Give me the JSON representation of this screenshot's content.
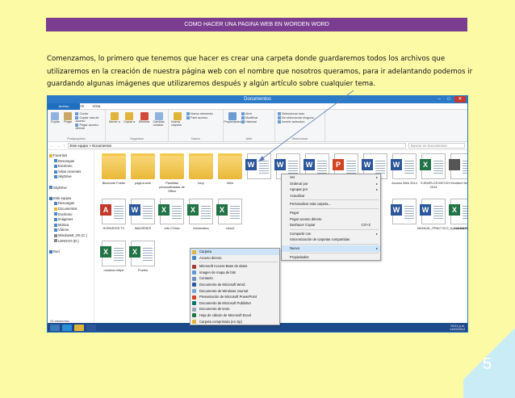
{
  "header": {
    "title": "COMO HACER UNA PAGINA WEB EN WORDEN WORD"
  },
  "intro": "Comenzamos, lo primero que tenemos que hacer es crear una carpeta donde guardaremos todos los archivos que utilizaremos en la creación de nuestra página web con el nombre que nosotros queramos, para ir adelantando podemos ir guardando algunas imágenes que utilizaremos después y algún artículo sobre cualquier tema.",
  "page_number": "5",
  "explorer": {
    "window_title": "Documentos",
    "ribbon_tabs": [
      "Archivo",
      "Inicio",
      "Compartir",
      "Vista"
    ],
    "ribbon": {
      "clipboard": {
        "name": "Portapapeles",
        "copy": "Copiar",
        "paste": "Pegar",
        "items": [
          "Cortar",
          "Copiar ruta de acceso",
          "Pegar acceso directo"
        ]
      },
      "organize": {
        "name": "Organizar",
        "items": [
          "Mover a",
          "Copiar a",
          "Eliminar",
          "Cambiar nombre"
        ]
      },
      "new": {
        "name": "Nuevo",
        "new_folder": "Nueva carpeta",
        "items": [
          "Nuevo elemento",
          "Fácil acceso"
        ]
      },
      "open": {
        "name": "Abrir",
        "properties": "Propiedades",
        "items": [
          "Abrir",
          "Modificar",
          "Historial"
        ]
      },
      "select": {
        "name": "Seleccionar",
        "items": [
          "Seleccionar todo",
          "No seleccionar ninguno",
          "Invertir selección"
        ]
      }
    },
    "address": "Este equipo > Documentos",
    "search_placeholder": "Buscar en Documentos",
    "nav": [
      {
        "label": "Favoritos",
        "indent": 0,
        "color": "#e0b43a"
      },
      {
        "label": "Descargas",
        "indent": 1,
        "color": "#4a86c8"
      },
      {
        "label": "Escritorio",
        "indent": 1,
        "color": "#4a86c8"
      },
      {
        "label": "Sitios recientes",
        "indent": 1,
        "color": "#4a86c8"
      },
      {
        "label": "SkyDrive",
        "indent": 1,
        "color": "#4a86c8"
      },
      {
        "label": "",
        "indent": 0,
        "color": ""
      },
      {
        "label": "SkyDrive",
        "indent": 0,
        "color": "#4a86c8"
      },
      {
        "label": "",
        "indent": 0,
        "color": ""
      },
      {
        "label": "Este equipo",
        "indent": 0,
        "color": "#3a78b8"
      },
      {
        "label": "Descargas",
        "indent": 1,
        "color": "#4a86c8"
      },
      {
        "label": "Documentos",
        "indent": 1,
        "color": "#e0b43a"
      },
      {
        "label": "Escritorio",
        "indent": 1,
        "color": "#4a86c8"
      },
      {
        "label": "Imágenes",
        "indent": 1,
        "color": "#4a86c8"
      },
      {
        "label": "Música",
        "indent": 1,
        "color": "#4a86c8"
      },
      {
        "label": "Vídeos",
        "indent": 1,
        "color": "#4a86c8"
      },
      {
        "label": "Windows8_OS (C:)",
        "indent": 1,
        "color": "#888888"
      },
      {
        "label": "LENOVO (D:)",
        "indent": 1,
        "color": "#888888"
      },
      {
        "label": "",
        "indent": 0,
        "color": ""
      },
      {
        "label": "Red",
        "indent": 0,
        "color": "#3a78b8"
      }
    ],
    "files_row1": [
      "Bluetooth Folder",
      "pagina web",
      "Plantillas personalizadas de Office",
      "tony",
      "Web",
      "",
      "",
      "",
      "",
      "",
      "Acceso Web 2014",
      "EJEMPLOS INFO 2014",
      "El+Hombre+fundamento+de+la+economia+"
    ],
    "files_row2": [
      "HORARIOS TC",
      "IMAGENES",
      "Info COrda",
      "informatica",
      "Libro2",
      "",
      "",
      "",
      "",
      "",
      "",
      "MANUAL_PRACTICO_8_CULINARIA_3",
      "modulos felipe"
    ],
    "files_row3": [
      "modulos felipe",
      "Pueblo"
    ],
    "status": "24 elementos",
    "clock_time": "09:11 p.m.",
    "clock_date": "11/02/2014"
  },
  "context_menu": {
    "items": [
      "Ver",
      "Ordenar por",
      "Agrupar por",
      "Actualizar",
      "",
      "Personalizar esta carpeta...",
      "",
      "Pegar",
      "Pegar acceso directo",
      "Deshacer Copiar",
      "",
      "Compartir con",
      "Sincronización de carpetas compartidas",
      "",
      "Nuevo",
      "",
      "Propiedades"
    ],
    "undo_shortcut": "Ctrl+Z"
  },
  "submenu": {
    "items": [
      {
        "label": "Carpeta",
        "color": "#e0b43a"
      },
      {
        "label": "Acceso directo",
        "color": "#4a86c8"
      },
      {
        "label": "",
        "color": ""
      },
      {
        "label": "Microsoft Access Base de datos",
        "color": "#a4373a"
      },
      {
        "label": "Imagen de mapa de bits",
        "color": "#5b9bd5"
      },
      {
        "label": "Contacto",
        "color": "#6a8fbf"
      },
      {
        "label": "Documento de Microsoft Word",
        "color": "#2b579a"
      },
      {
        "label": "Documento de Windows Journal",
        "color": "#7aa7d6"
      },
      {
        "label": "Presentación de Microsoft PowerPoint",
        "color": "#d04423"
      },
      {
        "label": "Documento de Microsoft Publisher",
        "color": "#077568"
      },
      {
        "label": "Documento de texto",
        "color": "#9aa6b2"
      },
      {
        "label": "Hoja de cálculo de Microsoft Excel",
        "color": "#217346"
      },
      {
        "label": "Carpeta comprimida (en zip)",
        "color": "#e0b43a"
      }
    ]
  }
}
